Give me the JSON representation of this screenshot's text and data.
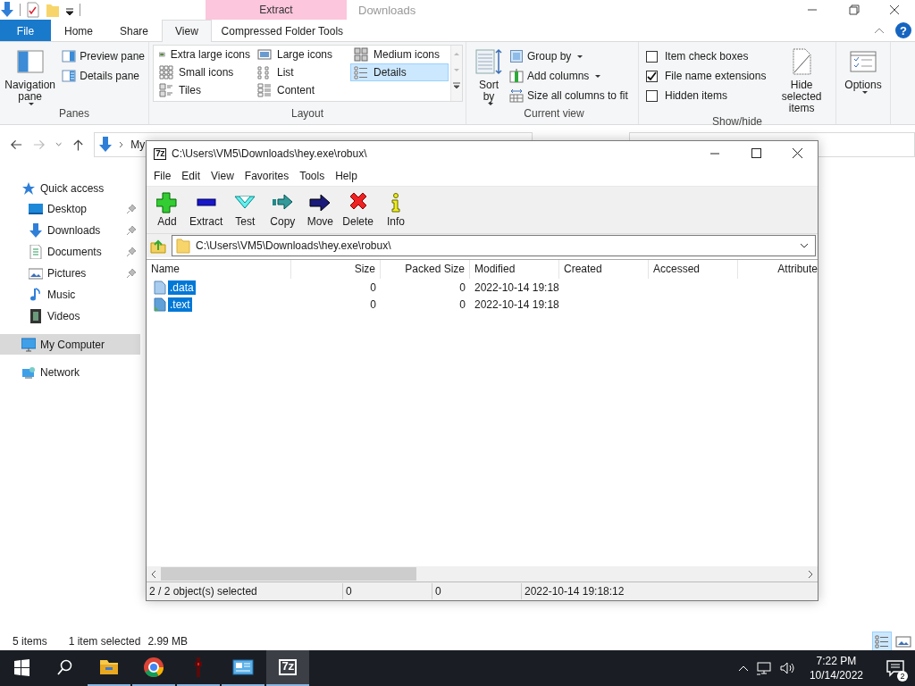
{
  "explorer": {
    "contextual_tab_group": "Extract",
    "title": "Downloads",
    "help_label": "?",
    "ribbon_tabs": [
      {
        "label": "File",
        "kind": "file",
        "selected": false
      },
      {
        "label": "Home",
        "kind": "tab",
        "selected": false
      },
      {
        "label": "Share",
        "kind": "tab",
        "selected": false
      },
      {
        "label": "View",
        "kind": "tab",
        "selected": true
      },
      {
        "label": "Compressed Folder Tools",
        "kind": "contextual",
        "selected": false
      }
    ],
    "ribbon_groups": [
      {
        "kind": "panes",
        "label": "Panes",
        "items": [
          {
            "kind": "large",
            "label": "Navigation pane",
            "dropdown": true
          },
          {
            "kind": "small",
            "label": "Preview pane",
            "dropdown": false
          },
          {
            "kind": "small",
            "label": "Details pane",
            "dropdown": false
          }
        ]
      },
      {
        "kind": "layout",
        "label": "Layout",
        "items": [
          {
            "kind": "gallery",
            "options": [
              {
                "label": "Extra large icons",
                "selected": false
              },
              {
                "label": "Large icons",
                "selected": false
              },
              {
                "label": "Medium icons",
                "selected": false
              },
              {
                "label": "Small icons",
                "selected": false
              },
              {
                "label": "List",
                "selected": false
              },
              {
                "label": "Details",
                "selected": true
              },
              {
                "label": "Tiles",
                "selected": false
              },
              {
                "label": "Content",
                "selected": false
              }
            ]
          }
        ]
      },
      {
        "kind": "current_view",
        "label": "Current view",
        "items": [
          {
            "kind": "large",
            "label": "Sort by",
            "dropdown": true
          },
          {
            "kind": "small",
            "label": "Group by",
            "dropdown": true
          },
          {
            "kind": "small",
            "label": "Add columns",
            "dropdown": true
          },
          {
            "kind": "small",
            "label": "Size all columns to fit",
            "dropdown": false
          }
        ]
      },
      {
        "kind": "show_hide",
        "label": "Show/hide",
        "items": [
          {
            "kind": "check",
            "label": "Item check boxes",
            "checked": false
          },
          {
            "kind": "check",
            "label": "File name extensions",
            "checked": true
          },
          {
            "kind": "check",
            "label": "Hidden items",
            "checked": false
          },
          {
            "kind": "large",
            "label": "Hide selected items",
            "dropdown": false
          }
        ]
      },
      {
        "kind": "options",
        "items": [
          {
            "kind": "large",
            "label": "Options",
            "dropdown": true
          }
        ]
      }
    ],
    "breadcrumb": [
      "My"
    ],
    "nav_tree": [
      {
        "label": "Quick access",
        "kind": "star",
        "selected": false,
        "pinned": false,
        "children": [
          {
            "label": "Desktop",
            "kind": "desktop",
            "selected": false,
            "pinned": true
          },
          {
            "label": "Downloads",
            "kind": "download",
            "selected": false,
            "pinned": true
          },
          {
            "label": "Documents",
            "kind": "document",
            "selected": false,
            "pinned": true
          },
          {
            "label": "Pictures",
            "kind": "pictures",
            "selected": false,
            "pinned": true
          },
          {
            "label": "Music",
            "kind": "music",
            "selected": false,
            "pinned": false
          },
          {
            "label": "Videos",
            "kind": "videos",
            "selected": false,
            "pinned": false
          }
        ]
      },
      {
        "label": "My Computer",
        "kind": "computer",
        "selected": true,
        "pinned": false
      },
      {
        "label": "Network",
        "kind": "network",
        "selected": false,
        "pinned": false
      }
    ],
    "status": {
      "item_count": "5 items",
      "selection": "1 item selected",
      "size": "2.99 MB"
    },
    "view_toggles": [
      {
        "kind": "details",
        "selected": true
      },
      {
        "kind": "large-icons",
        "selected": false
      }
    ]
  },
  "archive_window": {
    "logo": "7z",
    "title": "C:\\Users\\VM5\\Downloads\\hey.exe\\robux\\",
    "menu": [
      "File",
      "Edit",
      "View",
      "Favorites",
      "Tools",
      "Help"
    ],
    "toolbar": [
      {
        "label": "Add",
        "kind": "add"
      },
      {
        "label": "Extract",
        "kind": "extract"
      },
      {
        "label": "Test",
        "kind": "test"
      },
      {
        "label": "Copy",
        "kind": "copy"
      },
      {
        "label": "Move",
        "kind": "move"
      },
      {
        "label": "Delete",
        "kind": "delete"
      },
      {
        "label": "Info",
        "kind": "info"
      }
    ],
    "path": "C:\\Users\\VM5\\Downloads\\hey.exe\\robux\\",
    "columns": [
      "Name",
      "Size",
      "Packed Size",
      "Modified",
      "Created",
      "Accessed",
      "Attribute"
    ],
    "rows": [
      {
        "kind": "file",
        "selected": true,
        "cells": [
          ".data",
          "0",
          "0",
          "2022-10-14 19:18"
        ]
      },
      {
        "kind": "section",
        "selected": true,
        "cells": [
          ".text",
          "0",
          "0",
          "2022-10-14 19:18"
        ]
      }
    ],
    "status": [
      "2 / 2 object(s) selected",
      "0",
      "0",
      "2022-10-14 19:18:12"
    ]
  },
  "taskbar": {
    "apps": [
      {
        "kind": "explorer",
        "running": true,
        "active": false
      },
      {
        "kind": "chrome",
        "running": true,
        "active": false
      },
      {
        "kind": "figure",
        "running": true,
        "active": false
      },
      {
        "kind": "panel",
        "running": true,
        "active": false
      },
      {
        "kind": "archiver",
        "label": "7z",
        "running": true,
        "active": true
      }
    ],
    "clock": {
      "time": "7:22 PM",
      "date": "10/14/2022"
    },
    "notification_count": "2"
  }
}
